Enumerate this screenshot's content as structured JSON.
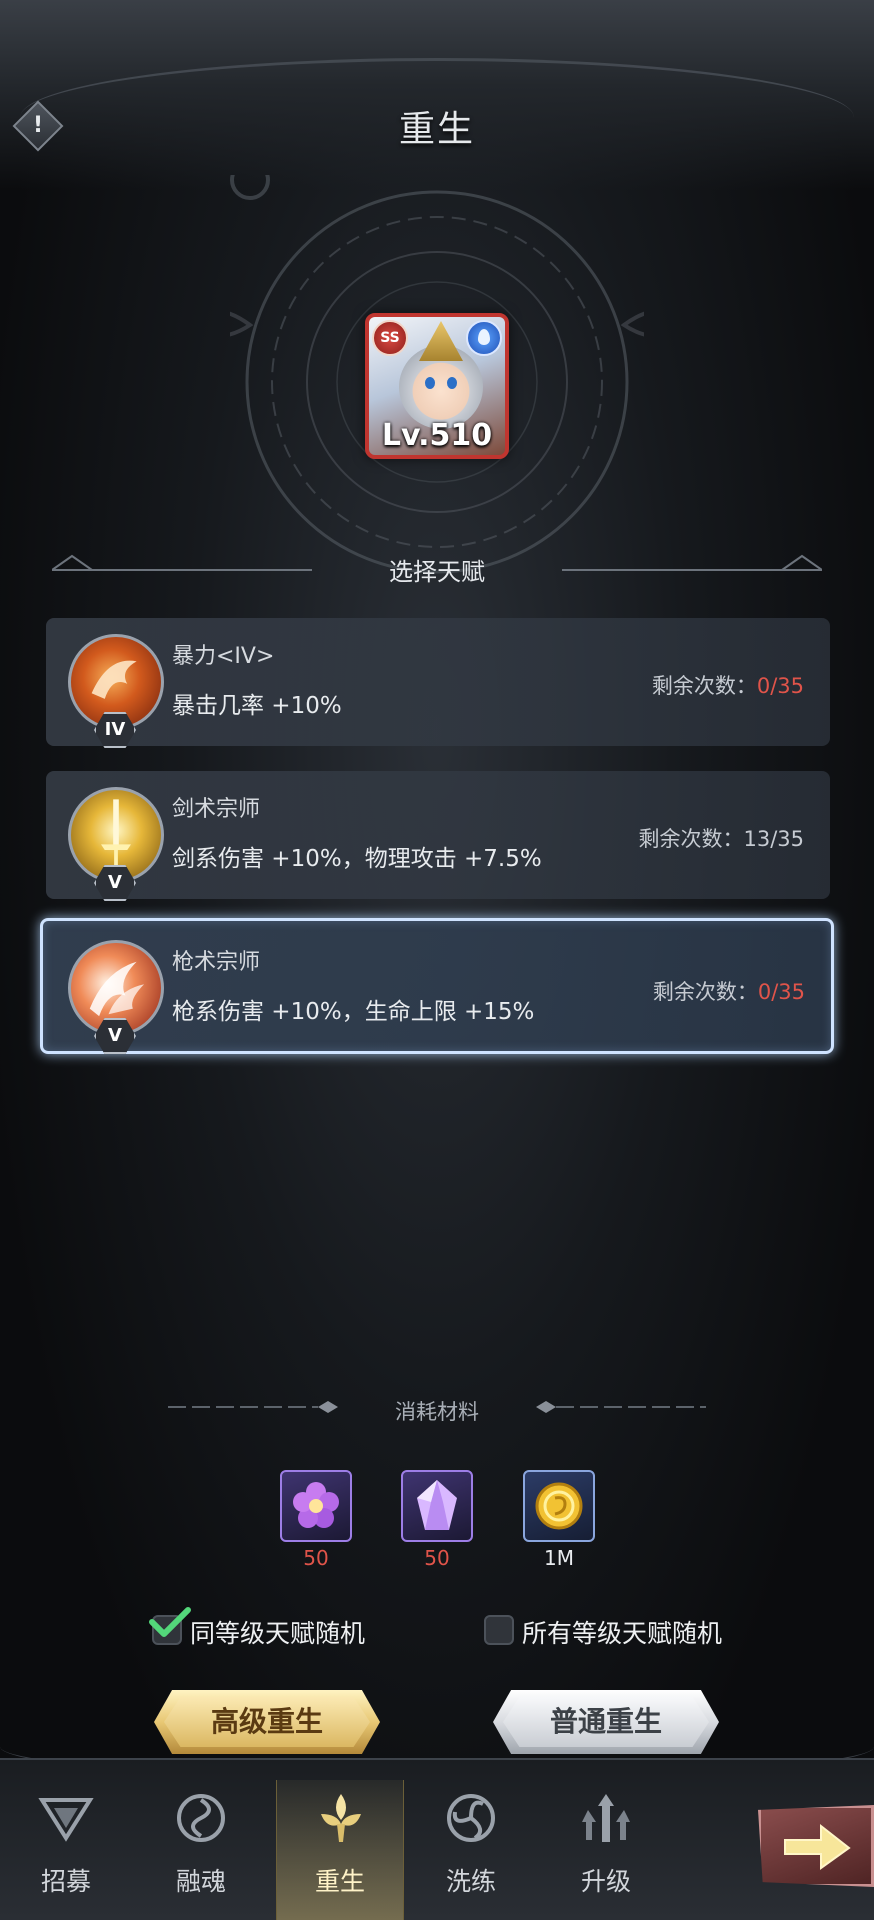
{
  "header": {
    "title": "重生",
    "info_icon": "!"
  },
  "hero": {
    "rarity": "SS",
    "level": "Lv.510"
  },
  "select_title": "选择天赋",
  "talents": [
    {
      "name": "暴力<IV>",
      "desc": "暴击几率 +10%",
      "rank": "IV",
      "remain_label": "剩余次数：",
      "remain_value": "0/35",
      "remain_color": "#e0544a"
    },
    {
      "name": "剑术宗师",
      "desc": "剑系伤害 +10%，物理攻击 +7.5%",
      "rank": "V",
      "remain_label": "剩余次数：",
      "remain_value": "13/35",
      "remain_color": "#c6cbd2"
    },
    {
      "name": "枪术宗师",
      "desc": "枪系伤害 +10%，生命上限 +15%",
      "rank": "V",
      "remain_label": "剩余次数：",
      "remain_value": "0/35",
      "remain_color": "#e0544a"
    }
  ],
  "materials": {
    "label": "消耗材料",
    "items": [
      {
        "icon": "purple-flower-icon",
        "count": "50"
      },
      {
        "icon": "crystal-icon",
        "count": "50"
      },
      {
        "icon": "gold-coin-icon",
        "count": "1M"
      }
    ]
  },
  "options": {
    "same_level": {
      "label": "同等级天赋随机",
      "checked": true
    },
    "all_levels": {
      "label": "所有等级天赋随机",
      "checked": false
    }
  },
  "buttons": {
    "advanced": "高级重生",
    "normal": "普通重生"
  },
  "nav": [
    {
      "label": "招募",
      "icon": "recruit-icon"
    },
    {
      "label": "融魂",
      "icon": "fuse-soul-icon"
    },
    {
      "label": "重生",
      "icon": "rebirth-icon",
      "active": true
    },
    {
      "label": "洗练",
      "icon": "refine-icon"
    },
    {
      "label": "升级",
      "icon": "upgrade-icon"
    }
  ]
}
